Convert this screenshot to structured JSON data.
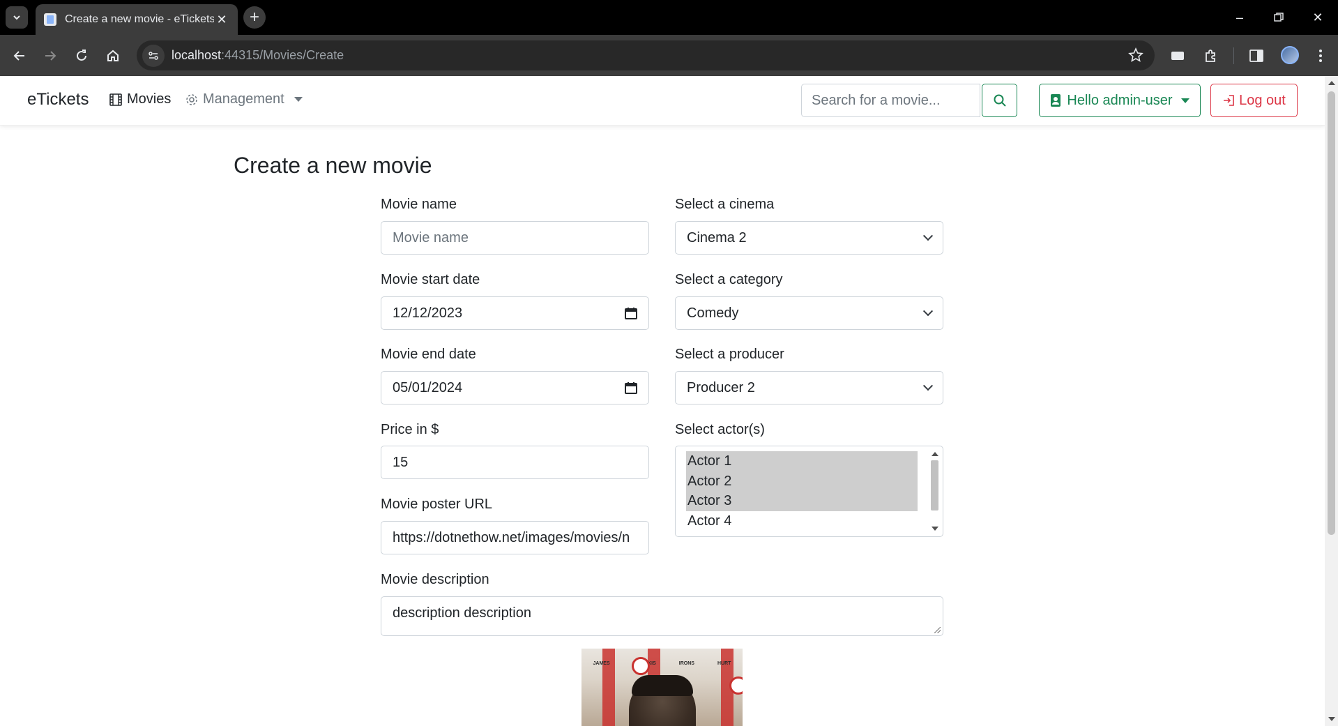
{
  "browser": {
    "tab_title": "Create a new movie - eTickets",
    "url_host": "localhost",
    "url_rest": ":44315/Movies/Create"
  },
  "navbar": {
    "brand": "eTickets",
    "movies_link": "Movies",
    "management_link": "Management",
    "search_placeholder": "Search for a movie...",
    "user_button": "Hello admin-user",
    "logout_button": "Log out"
  },
  "form": {
    "title": "Create a new movie",
    "movie_name": {
      "label": "Movie name",
      "placeholder": "Movie name",
      "value": ""
    },
    "start_date": {
      "label": "Movie start date",
      "value": "12/12/2023"
    },
    "end_date": {
      "label": "Movie end date",
      "value": "05/01/2024"
    },
    "price": {
      "label": "Price in $",
      "value": "15"
    },
    "poster_url": {
      "label": "Movie poster URL",
      "value": "https://dotnethow.net/images/movies/n"
    },
    "description": {
      "label": "Movie description",
      "value": "description description"
    },
    "cinema": {
      "label": "Select a cinema",
      "value": "Cinema 2"
    },
    "category": {
      "label": "Select a category",
      "value": "Comedy"
    },
    "producer": {
      "label": "Select a producer",
      "value": "Producer 2"
    },
    "actors": {
      "label": "Select actor(s)",
      "options": [
        {
          "label": "Actor 1",
          "selected": true
        },
        {
          "label": "Actor 2",
          "selected": true
        },
        {
          "label": "Actor 3",
          "selected": true
        },
        {
          "label": "Actor 4",
          "selected": false
        }
      ]
    },
    "poster_credits": [
      "JAMES",
      "SUDEIKIS",
      "IRONS",
      "HURT"
    ]
  },
  "colors": {
    "success": "#198754",
    "danger": "#dc3545",
    "muted": "#6c757d"
  }
}
